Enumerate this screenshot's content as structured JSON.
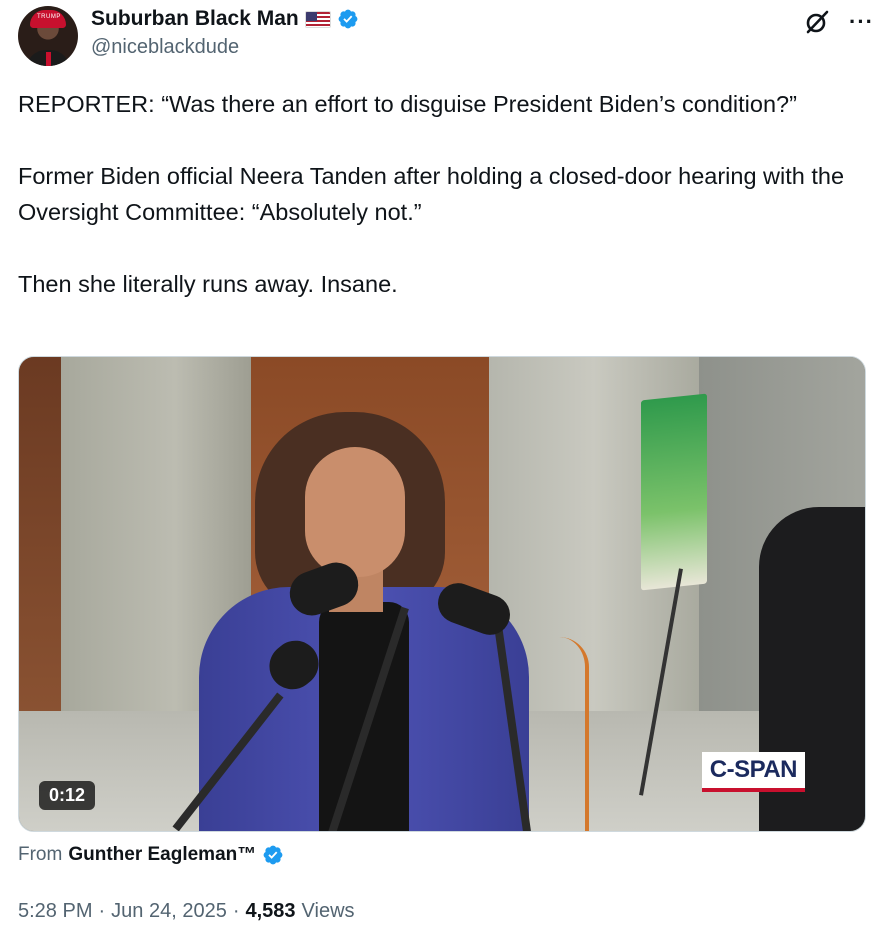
{
  "author": {
    "display_name": "Suburban Black Man",
    "handle": "@niceblackdude",
    "flag_emoji_icon": "us-flag-icon",
    "verified": true,
    "verified_color": "#1d9bf0",
    "avatar_cap_text": "TRUMP"
  },
  "header_actions": {
    "grok_icon": "grok-icon",
    "more_label": "···"
  },
  "tweet": {
    "paragraphs": [
      "REPORTER: “Was there an effort to disguise President Biden’s condition?”",
      "Former Biden official Neera Tanden after holding a closed-door hearing with the Oversight Committee: “Absolutely not.”",
      "Then she literally runs away. Insane."
    ]
  },
  "media": {
    "duration": "0:12",
    "logo_text": "C-SPAN"
  },
  "attribution": {
    "prefix": "From",
    "source_name": "Gunther Eagleman™",
    "verified": true
  },
  "meta": {
    "time": "5:28 PM",
    "separator": "·",
    "date": "Jun 24, 2025",
    "views_count": "4,583",
    "views_label": "Views"
  }
}
